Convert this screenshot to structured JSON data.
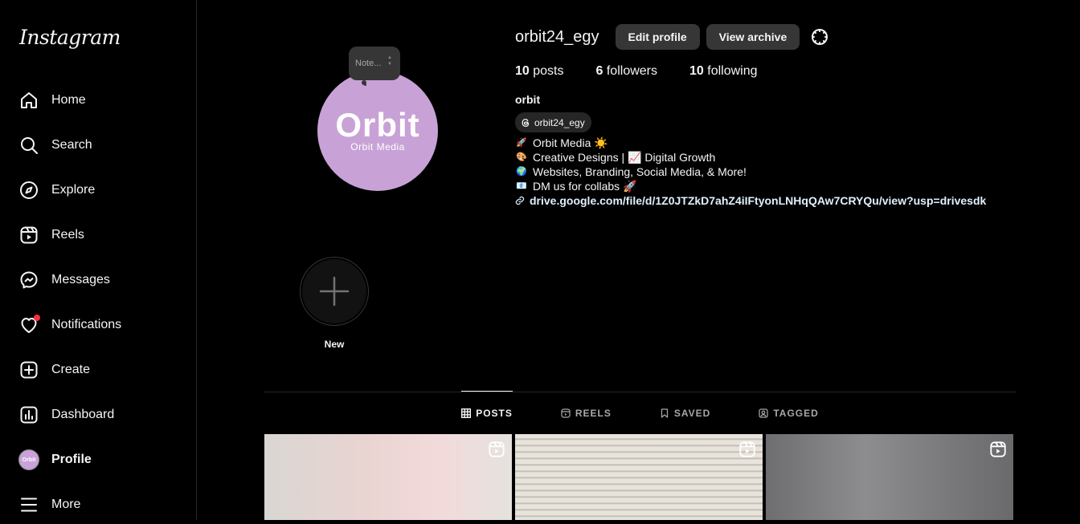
{
  "sidebar": {
    "logo": "Instagram",
    "items": [
      {
        "label": "Home",
        "icon": "home-icon"
      },
      {
        "label": "Search",
        "icon": "search-icon"
      },
      {
        "label": "Explore",
        "icon": "compass-icon"
      },
      {
        "label": "Reels",
        "icon": "reels-icon"
      },
      {
        "label": "Messages",
        "icon": "messenger-icon"
      },
      {
        "label": "Notifications",
        "icon": "heart-icon"
      },
      {
        "label": "Create",
        "icon": "plus-square-icon"
      },
      {
        "label": "Dashboard",
        "icon": "chart-icon"
      },
      {
        "label": "Profile",
        "icon": "avatar"
      },
      {
        "label": "More",
        "icon": "menu-icon"
      }
    ],
    "mini_avatar_text": "Orbit"
  },
  "profile": {
    "username": "orbit24_egy",
    "edit_label": "Edit profile",
    "archive_label": "View archive",
    "posts_count": "10",
    "posts_label": "posts",
    "followers_count": "6",
    "followers_label": "followers",
    "following_count": "10",
    "following_label": "following",
    "full_name": "orbit",
    "threads_handle": "orbit24_egy",
    "note_placeholder": "Note...",
    "avatar_brand": "Orbit",
    "avatar_sub": "Orbit Media",
    "bio": [
      {
        "emoji": "🚀",
        "text": "Orbit Media ☀️"
      },
      {
        "emoji": "🎨",
        "text": "Creative Designs | 📈 Digital Growth"
      },
      {
        "emoji": "🌍",
        "text": "Websites, Branding, Social Media, & More!"
      },
      {
        "emoji": "📧",
        "text": "DM us for collabs 🚀"
      }
    ],
    "link": "drive.google.com/file/d/1Z0JTZkD7ahZ4iIFtyonLNHqQAw7CRYQu/view?usp=drivesdk"
  },
  "highlight": {
    "label": "New"
  },
  "tabs": [
    {
      "label": "POSTS",
      "icon": "grid-icon",
      "active": true
    },
    {
      "label": "REELS",
      "icon": "reels-icon",
      "active": false
    },
    {
      "label": "SAVED",
      "icon": "bookmark-icon",
      "active": false
    },
    {
      "label": "TAGGED",
      "icon": "tag-user-icon",
      "active": false
    }
  ],
  "colors": {
    "background": "#000000",
    "button": "#363636",
    "notification_dot": "#ff3040",
    "link": "#e0f1ff",
    "avatar_bg": "#c8a2d6"
  }
}
